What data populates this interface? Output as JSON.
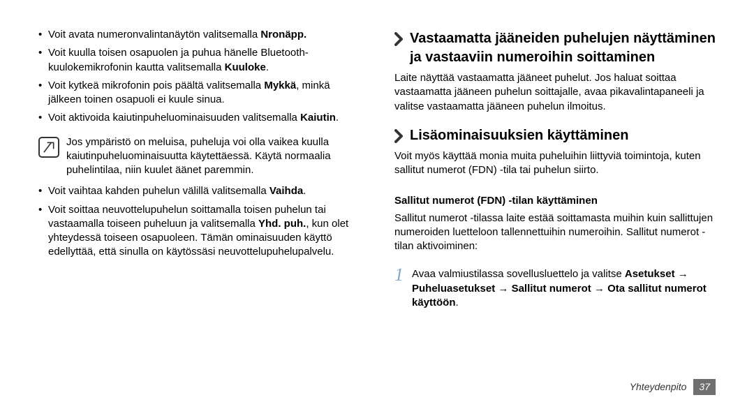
{
  "left": {
    "b1_pre": "Voit avata numeronvalintanäytön valitsemalla ",
    "b1_bold": "Nronäpp.",
    "b2_pre": "Voit kuulla toisen osapuolen ja puhua hänelle Bluetooth-kuulokemikrofonin kautta valitsemalla ",
    "b2_bold": "Kuuloke",
    "b3_pre": "Voit kytkeä mikrofonin pois päältä valitsemalla ",
    "b3_bold": "Mykkä",
    "b3_post": ", minkä jälkeen toinen osapuoli ei kuule sinua.",
    "b4_pre": "Voit aktivoida kaiutinpuheluominaisuuden valitsemalla ",
    "b4_bold": "Kaiutin",
    "note": "Jos ympäristö on meluisa, puheluja voi olla vaikea kuulla kaiutinpuheluominaisuutta käytettäessä. Käytä normaalia puhelintilaa, niin kuulet äänet paremmin.",
    "b5_pre": "Voit vaihtaa kahden puhelun välillä valitsemalla ",
    "b5_bold": "Vaihda",
    "b6_pre": "Voit soittaa neuvottelupuhelun soittamalla toisen puhelun tai vastaamalla toiseen puheluun ja valitsemalla ",
    "b6_bold": "Yhd. puh.",
    "b6_post": ", kun olet yhteydessä toiseen osapuoleen. Tämän ominaisuuden käyttö edellyttää, että sinulla on käytössäsi neuvottelupuhelupalvelu."
  },
  "right": {
    "h1": "Vastaamatta jääneiden puhelujen näyttäminen ja vastaaviin numeroihin soittaminen",
    "p1": "Laite näyttää vastaamatta jääneet puhelut. Jos haluat soittaa vastaamatta jääneen puhelun soittajalle, avaa pikavalintapaneeli ja valitse vastaamatta jääneen puhelun ilmoitus.",
    "h2": "Lisäominaisuuksien käyttäminen",
    "p2": "Voit myös käyttää monia muita puheluihin liittyviä toimintoja, kuten sallitut numerot (FDN) -tila tai puhelun siirto.",
    "sub1": "Sallitut numerot (FDN) -tilan käyttäminen",
    "p3": "Sallitut numerot -tilassa laite estää soittamasta muihin kuin sallittujen numeroiden luetteloon tallennettuihin numeroihin. Sallitut numerot -tilan aktivoiminen:",
    "step_num": "1",
    "step_pre": "Avaa valmiustilassa sovellusluettelo ja valitse ",
    "step_b1": "Asetukset",
    "step_arrow": " → ",
    "step_b2": "Puheluasetukset",
    "step_b3": "Sallitut numerot",
    "step_b4": "Ota sallitut numerot käyttöön"
  },
  "footer": {
    "label": "Yhteydenpito",
    "page": "37"
  }
}
